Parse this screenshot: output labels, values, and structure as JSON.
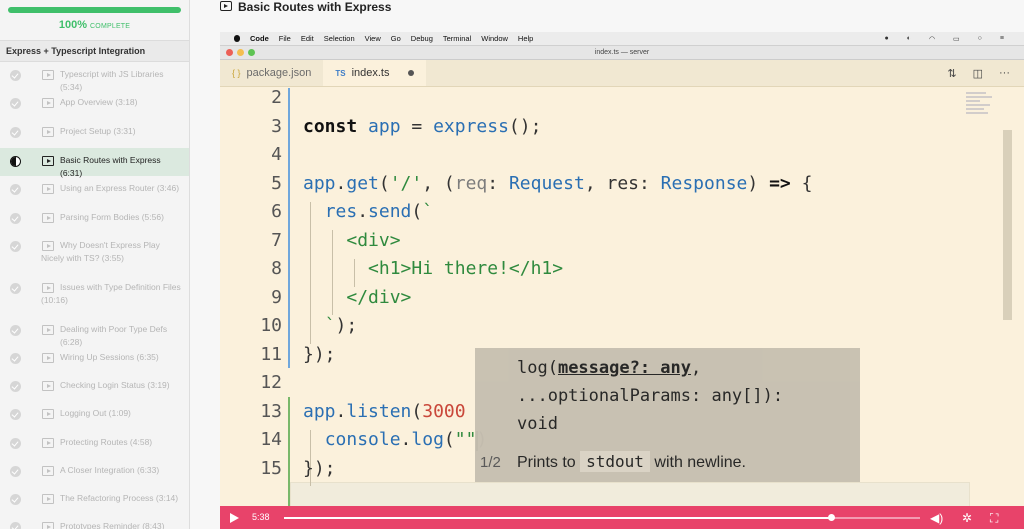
{
  "sidebar": {
    "progress_percent": 100,
    "progress_label": "100%",
    "progress_suffix": "COMPLETE",
    "section_title": "Express + Typescript Integration",
    "lessons": [
      {
        "label": "Typescript with JS Libraries (5:34)"
      },
      {
        "label": "App Overview (3:18)"
      },
      {
        "label": "Project Setup (3:31)"
      },
      {
        "label": "Basic Routes with Express (6:31)"
      },
      {
        "label": "Using an Express Router (3:46)"
      },
      {
        "label": "Parsing Form Bodies (5:56)"
      },
      {
        "label": "Why Doesn't Express Play Nicely with TS? (3:55)"
      },
      {
        "label": "Issues with Type Definition Files (10:16)"
      },
      {
        "label": "Dealing with Poor Type Defs (6:28)"
      },
      {
        "label": "Wiring Up Sessions (6:35)"
      },
      {
        "label": "Checking Login Status (3:19)"
      },
      {
        "label": "Logging Out (1:09)"
      },
      {
        "label": "Protecting Routes (4:58)"
      },
      {
        "label": "A Closer Integration (6:33)"
      },
      {
        "label": "The Refactoring Process (3:14)"
      },
      {
        "label": "Prototypes Reminder (8:43)"
      }
    ]
  },
  "video": {
    "title": "Basic Routes with Express",
    "menubar": [
      "Code",
      "File",
      "Edit",
      "Selection",
      "View",
      "Go",
      "Debug",
      "Terminal",
      "Window",
      "Help"
    ],
    "window_title": "index.ts — server",
    "tabs": [
      {
        "label": "package.json",
        "badge": "{ }"
      },
      {
        "label": "index.ts",
        "badge": "TS"
      }
    ],
    "tooltip": {
      "counter": "1/2",
      "sig_name": "log(",
      "sig_param": "message?: any",
      "sig_rest": ",",
      "sig_line2": "...optionalParams: any[]):",
      "sig_line3": "void",
      "desc_pre": "Prints to ",
      "desc_code": "stdout",
      "desc_post": " with newline."
    },
    "player": {
      "time": "5:38",
      "progress_fraction": 0.86
    }
  }
}
